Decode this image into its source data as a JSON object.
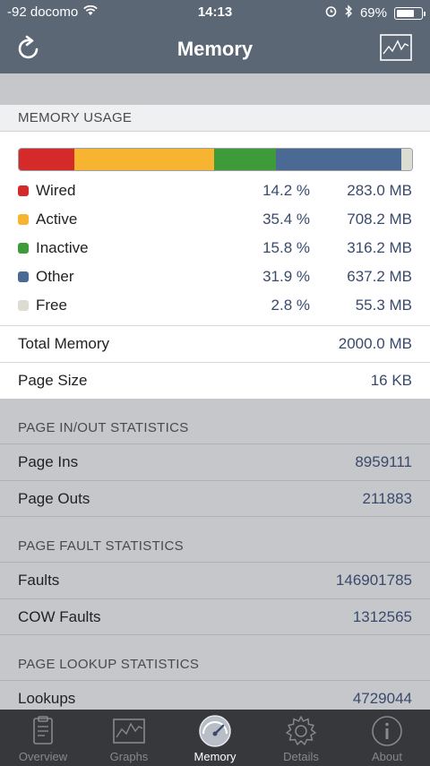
{
  "status_bar": {
    "carrier": "-92 docomo",
    "time": "14:13",
    "battery": "69%"
  },
  "nav": {
    "title": "Memory"
  },
  "memory_usage": {
    "header": "MEMORY USAGE",
    "segments": [
      {
        "name": "Wired",
        "percent": "14.2 %",
        "value": "283.0 MB",
        "color": "#d42a2a",
        "fraction": 0.142
      },
      {
        "name": "Active",
        "percent": "35.4 %",
        "value": "708.2 MB",
        "color": "#f6b431",
        "fraction": 0.354
      },
      {
        "name": "Inactive",
        "percent": "15.8 %",
        "value": "316.2 MB",
        "color": "#3e9b3a",
        "fraction": 0.158
      },
      {
        "name": "Other",
        "percent": "31.9 %",
        "value": "637.2 MB",
        "color": "#4a6a93",
        "fraction": 0.319
      },
      {
        "name": "Free",
        "percent": "2.8 %",
        "value": "55.3 MB",
        "color": "#dcdcd2",
        "fraction": 0.028
      }
    ],
    "total_label": "Total Memory",
    "total_value": "2000.0 MB",
    "page_size_label": "Page Size",
    "page_size_value": "16 KB"
  },
  "page_inout": {
    "header": "PAGE IN/OUT STATISTICS",
    "rows": [
      {
        "label": "Page Ins",
        "value": "8959111"
      },
      {
        "label": "Page Outs",
        "value": "211883"
      }
    ]
  },
  "page_fault": {
    "header": "PAGE FAULT STATISTICS",
    "rows": [
      {
        "label": "Faults",
        "value": "146901785"
      },
      {
        "label": "COW Faults",
        "value": "1312565"
      }
    ]
  },
  "page_lookup": {
    "header": "PAGE LOOKUP STATISTICS",
    "rows": [
      {
        "label": "Lookups",
        "value": "4729044"
      }
    ]
  },
  "tabs": [
    {
      "label": "Overview",
      "icon": "clipboard-icon",
      "active": false
    },
    {
      "label": "Graphs",
      "icon": "line-graph-icon",
      "active": false
    },
    {
      "label": "Memory",
      "icon": "gauge-icon",
      "active": true
    },
    {
      "label": "Details",
      "icon": "gear-icon",
      "active": false
    },
    {
      "label": "About",
      "icon": "info-icon",
      "active": false
    }
  ]
}
